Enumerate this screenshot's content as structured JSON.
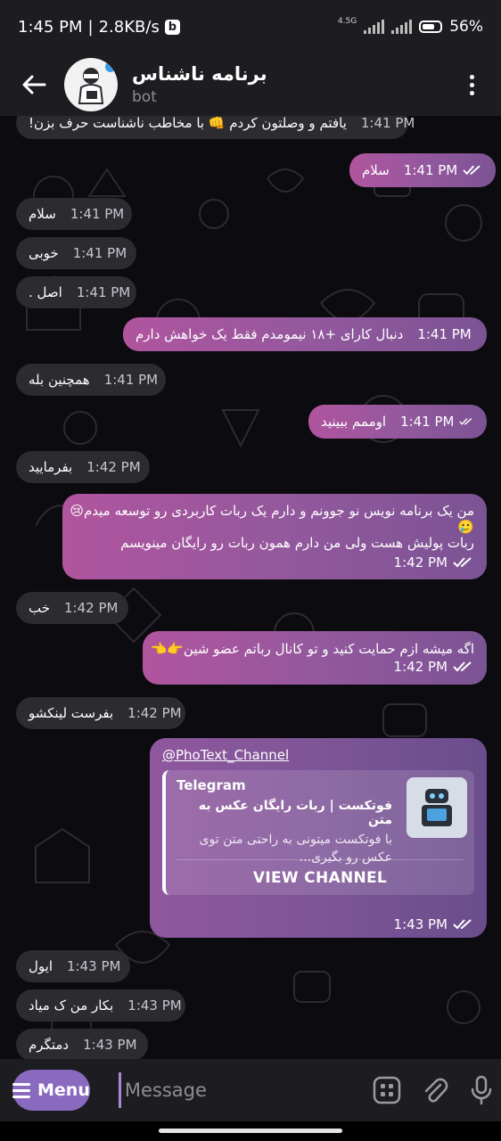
{
  "status_bar": {
    "time": "1:45 PM",
    "speed": "2.8KB/s",
    "badge": "b",
    "network": "4.5G",
    "battery": "56%"
  },
  "header": {
    "title": "برنامه ناشناس",
    "subtitle": "bot",
    "avatar_icon": "bot-avatar-icon"
  },
  "messages": [
    {
      "dir": "in",
      "text": "یافتم و وصلتون کردم 👊 با مخاطب ناشناست حرف بزن!",
      "time": "1:41 PM"
    },
    {
      "dir": "out",
      "text": "سلام",
      "time": "1:41 PM"
    },
    {
      "dir": "in",
      "text": "سلام",
      "time": "1:41 PM"
    },
    {
      "dir": "in",
      "text": "خوبی",
      "time": "1:41 PM"
    },
    {
      "dir": "in",
      "text": "اصل .",
      "time": "1:41 PM"
    },
    {
      "dir": "out",
      "text": "دنبال کارای +۱۸ نیمومدم فقط یک خواهش دارم",
      "time": "1:41 PM"
    },
    {
      "dir": "in",
      "text": "همچنین بله",
      "time": "1:41 PM"
    },
    {
      "dir": "out",
      "text": "اوممم ببینید",
      "time": "1:41 PM"
    },
    {
      "dir": "in",
      "text": "بفرمایید",
      "time": "1:42 PM"
    },
    {
      "dir": "out",
      "line1": "من یک  برنامه نویس نو جوونم و دارم یک ربات کاربردی رو توسعه میدم😢",
      "line2": "🥲",
      "line3": "ربات پولیش هست ولی من دارم همون ربات رو رایگان مینویسم",
      "time": "1:42 PM"
    },
    {
      "dir": "in",
      "text": "خب",
      "time": "1:42 PM"
    },
    {
      "dir": "out",
      "text": "اگه میشه ازم حمایت کنید و تو کانال رباتم عضو شین👉👈",
      "time": "1:42 PM"
    },
    {
      "dir": "in",
      "text": "بفرست لینکشو",
      "time": "1:42 PM"
    },
    {
      "dir": "in",
      "text": "ایول",
      "time": "1:43 PM"
    },
    {
      "dir": "in",
      "text": "بکار من ک میاد",
      "time": "1:43 PM"
    },
    {
      "dir": "in",
      "text": "دمتگرم",
      "time": "1:43 PM"
    }
  ],
  "link_message": {
    "url": "@PhoText_Channel",
    "site": "Telegram",
    "title": "فوتکست | ربات رایگان عکس به متن",
    "desc_line1": "با فوتکست میتونی به راحتی متن توی",
    "desc_line2": "عکس رو بگیری...",
    "button": "VIEW CHANNEL",
    "time": "1:43 PM"
  },
  "composer": {
    "menu_label": "Menu",
    "placeholder": "Message"
  },
  "colors": {
    "out_bubble": "#a0579d",
    "in_bubble": "#2b2b30",
    "bar_bg": "#1d1d21",
    "accent": "#8a6abf"
  }
}
